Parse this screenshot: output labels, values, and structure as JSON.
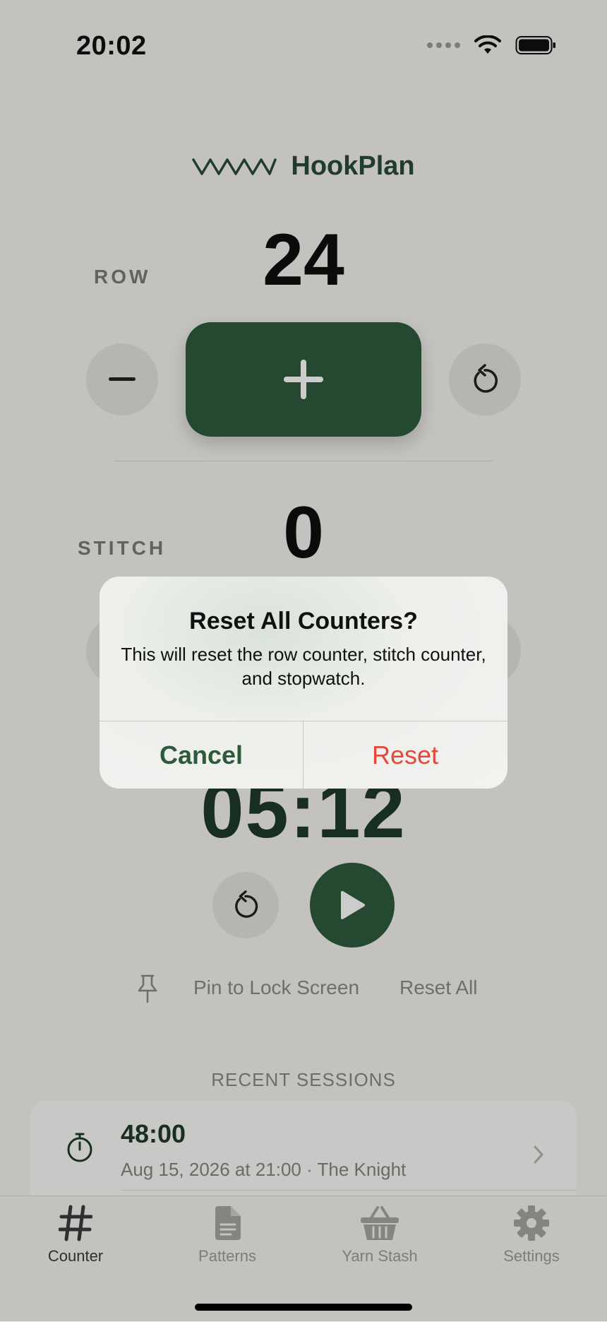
{
  "status_bar": {
    "time": "20:02"
  },
  "brand": {
    "name": "HookPlan",
    "logo_icon": "zigzag-stitch-icon"
  },
  "row_counter": {
    "label": "ROW",
    "value": "24"
  },
  "stitch_counter": {
    "label": "STITCH",
    "value": "0"
  },
  "stopwatch": {
    "time": "05:12"
  },
  "actions": {
    "pin_label": "Pin to Lock Screen",
    "reset_all_label": "Reset All"
  },
  "recent_sessions": {
    "title": "RECENT SESSIONS",
    "items": [
      {
        "duration": "48:00",
        "subtitle": "Aug 15, 2026 at 21:00 · The Knight"
      }
    ]
  },
  "tabs": [
    {
      "label": "Counter",
      "icon": "hash-icon",
      "active": true
    },
    {
      "label": "Patterns",
      "icon": "document-icon",
      "active": false
    },
    {
      "label": "Yarn Stash",
      "icon": "basket-icon",
      "active": false
    },
    {
      "label": "Settings",
      "icon": "gear-icon",
      "active": false
    }
  ],
  "dialog": {
    "title": "Reset All Counters?",
    "message": "This will reset the row counter, stitch counter, and stopwatch.",
    "cancel_label": "Cancel",
    "confirm_label": "Reset"
  },
  "colors": {
    "accent": "#2e5a3c",
    "destructive": "#e5483a",
    "background": "#f4f3ee"
  }
}
